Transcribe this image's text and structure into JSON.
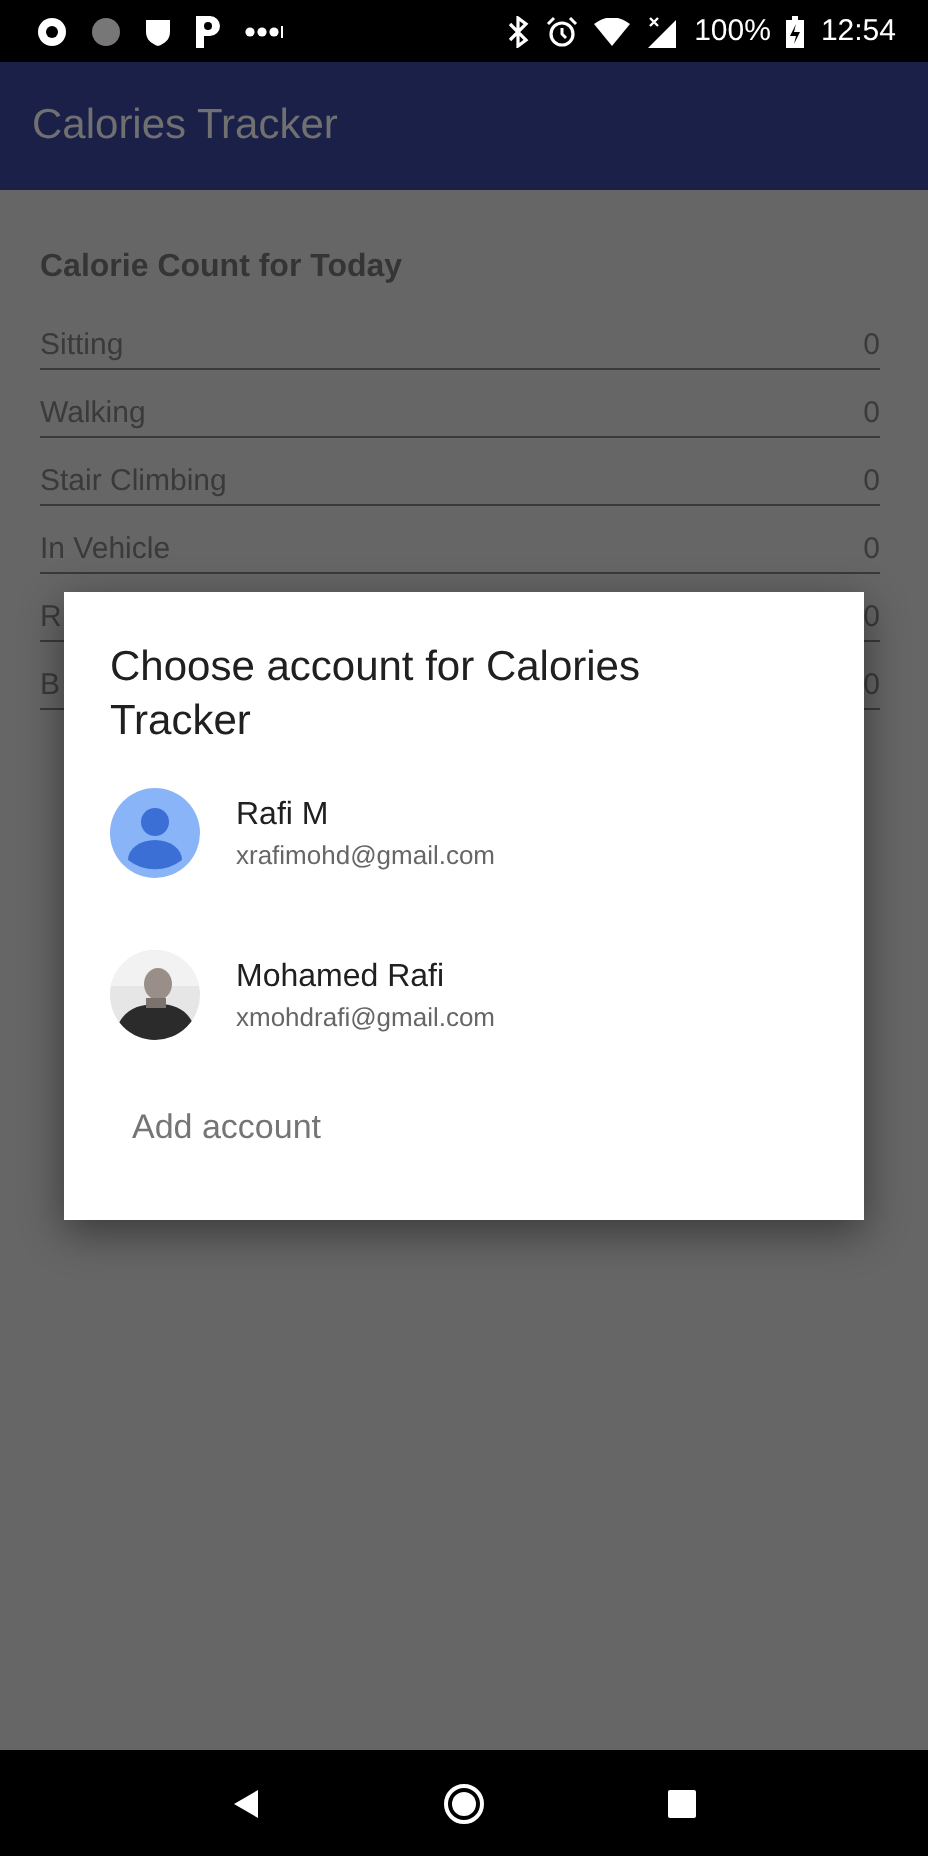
{
  "status_bar": {
    "battery": "100%",
    "time": "12:54"
  },
  "app_bar": {
    "title": "Calories Tracker"
  },
  "section": {
    "title": "Calorie Count for Today",
    "rows": [
      {
        "label": "Sitting",
        "value": "0"
      },
      {
        "label": "Walking",
        "value": "0"
      },
      {
        "label": "Stair Climbing",
        "value": "0"
      },
      {
        "label": "In Vehicle",
        "value": "0"
      },
      {
        "label": "R",
        "value": "0"
      },
      {
        "label": "B",
        "value": "0"
      }
    ]
  },
  "dialog": {
    "title": "Choose account for Calories Tracker",
    "accounts": [
      {
        "name": "Rafi M",
        "email": "xrafimohd@gmail.com",
        "kind": "default"
      },
      {
        "name": "Mohamed Rafi",
        "email": "xmohdrafi@gmail.com",
        "kind": "picture"
      }
    ],
    "add_label": "Add account"
  }
}
